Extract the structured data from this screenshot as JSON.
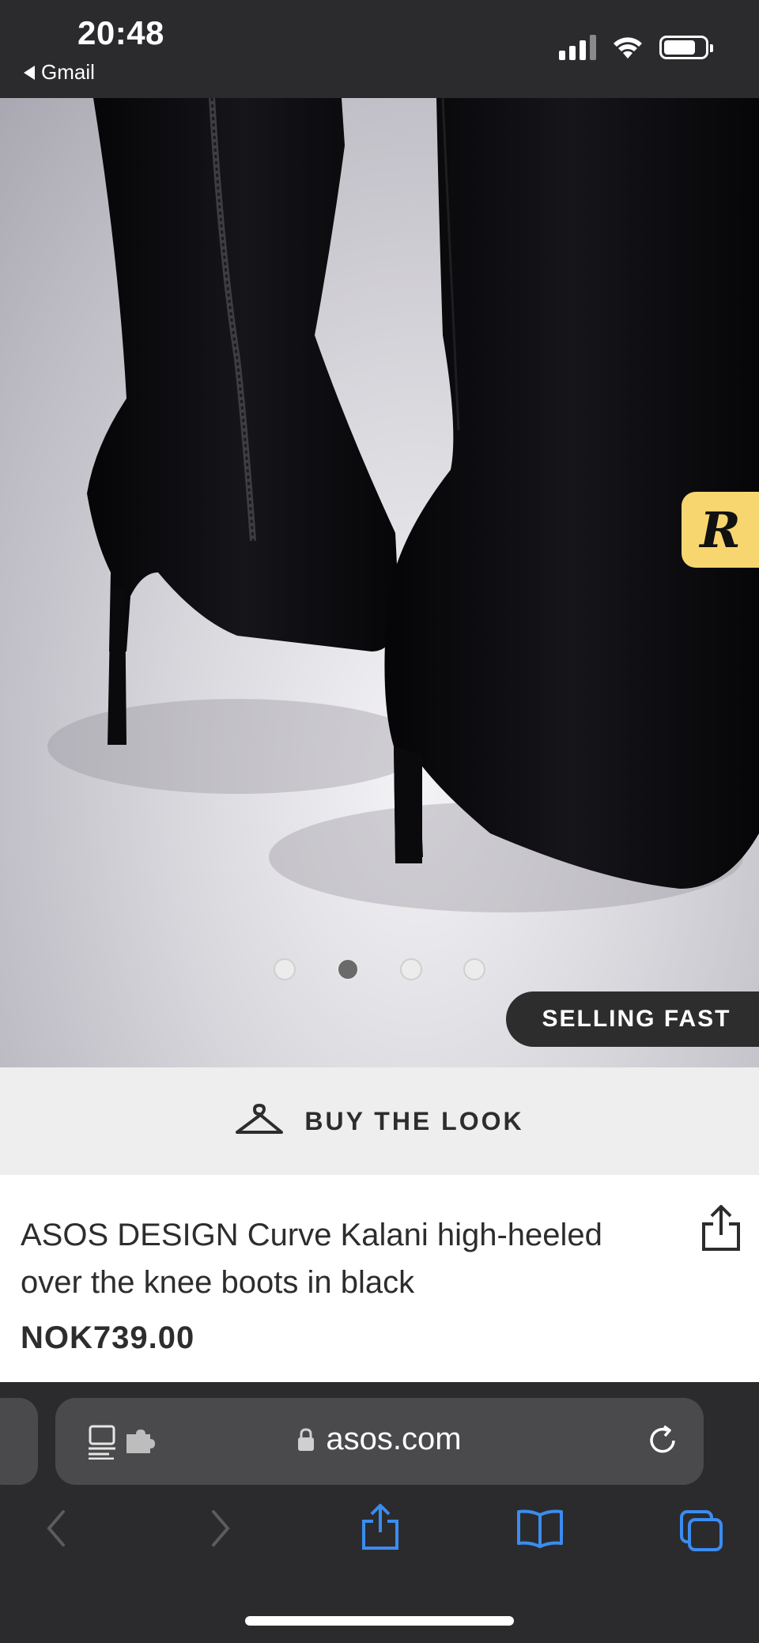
{
  "status_bar": {
    "time": "20:48",
    "back_label": "Gmail"
  },
  "product_image": {
    "carousel_dot_count": 4,
    "active_dot_index": 1,
    "badge": "SELLING FAST",
    "floating_badge_letter": "R"
  },
  "buy_the_look": {
    "label": "BUY THE LOOK"
  },
  "product": {
    "title": "ASOS DESIGN Curve Kalani high-heeled over the knee boots in black",
    "price": "NOK739.00"
  },
  "browser": {
    "url": "asos.com"
  },
  "colors": {
    "chrome_bg": "#2b2b2d",
    "address_bar_bg": "#4a4a4c",
    "toolbar_accent": "#3b8cf0",
    "badge_yellow": "#f8d66f"
  }
}
